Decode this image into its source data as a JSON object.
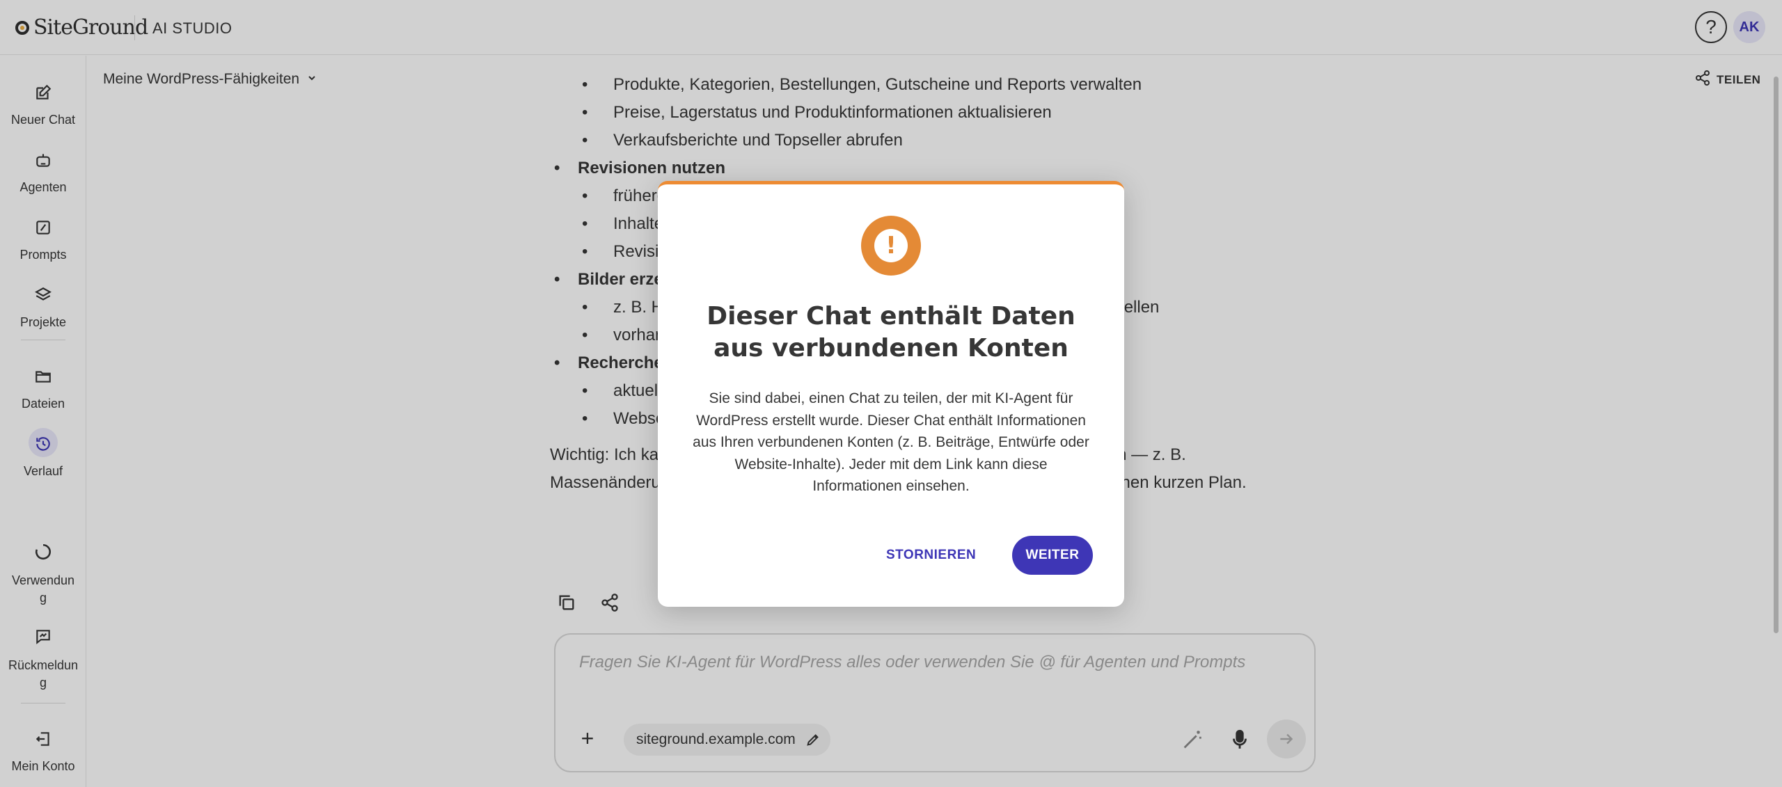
{
  "header": {
    "logo_text": "SiteGround",
    "app_name": "AI STUDIO",
    "help_icon": "?",
    "avatar_initials": "AK"
  },
  "sidebar": {
    "items": [
      {
        "label": "Neuer Chat",
        "icon": "new-chat-icon"
      },
      {
        "label": "Agenten",
        "icon": "robot-icon"
      },
      {
        "label": "Prompts",
        "icon": "prompt-icon"
      },
      {
        "label": "Projekte",
        "icon": "layers-icon"
      },
      {
        "label": "Dateien",
        "icon": "folder-icon"
      },
      {
        "label": "Verlauf",
        "icon": "history-icon"
      },
      {
        "label": "Verwendung",
        "icon": "usage-icon"
      },
      {
        "label": "Rückmeldung",
        "icon": "feedback-icon"
      },
      {
        "label": "Mein Konto",
        "icon": "account-icon"
      }
    ]
  },
  "chat": {
    "title": "Meine WordPress-Fähigkeiten",
    "share_label": "TEILEN",
    "lines": {
      "l0": "Produkte, Kategorien, Bestellungen, Gutscheine und Reports verwalten",
      "l1": "Preise, Lagerstatus und Produktinformationen aktualisieren",
      "l2": "Verkaufsberichte und Topseller abrufen",
      "l3": "Revisionen nutzen",
      "l4": "frühere Versionen anzeigen",
      "l5": "Inhalte wiederherstellen",
      "l6": "Revisionen nur nach Rückfrage, wenn du das ausdrücklich bestätigst",
      "l7": "Bilder erzeugen",
      "l8": "z. B. Hero-Bilder, Beitragsbilder oder alternative Designvarianten erstellen",
      "l9": "vorhandene Bilder bearbeiten",
      "l10": "Recherche",
      "l11": "aktuelle Informationen suchen",
      "l12": "Webseiten analysieren"
    },
    "note": "Wichtig: Ich kann nicht alles ohne Rückfrage erledigen. Bei riskanten Aktionen — z. B. Massenänderungen oder dem Löschen von Inhalten — zeige ich dir vorher einen kurzen Plan."
  },
  "composer": {
    "placeholder": "Fragen Sie KI-Agent für WordPress alles oder verwenden Sie @ für Agenten und Prompts",
    "site_chip": "siteground.example.com"
  },
  "modal": {
    "title": "Dieser Chat enthält Daten aus verbundenen Konten",
    "body": "Sie sind dabei, einen Chat zu teilen, der mit KI-Agent für WordPress erstellt wurde. Dieser Chat enthält Informationen aus Ihren verbundenen Konten (z. B. Beiträge, Entwürfe oder Website-Inhalte). Jeder mit dem Link kann diese Informationen einsehen.",
    "cancel_label": "STORNIEREN",
    "continue_label": "WEITER",
    "warning_icon": "!"
  },
  "colors": {
    "accent": "#3e36b6",
    "warning": "#e48a36",
    "text": "#363636"
  }
}
